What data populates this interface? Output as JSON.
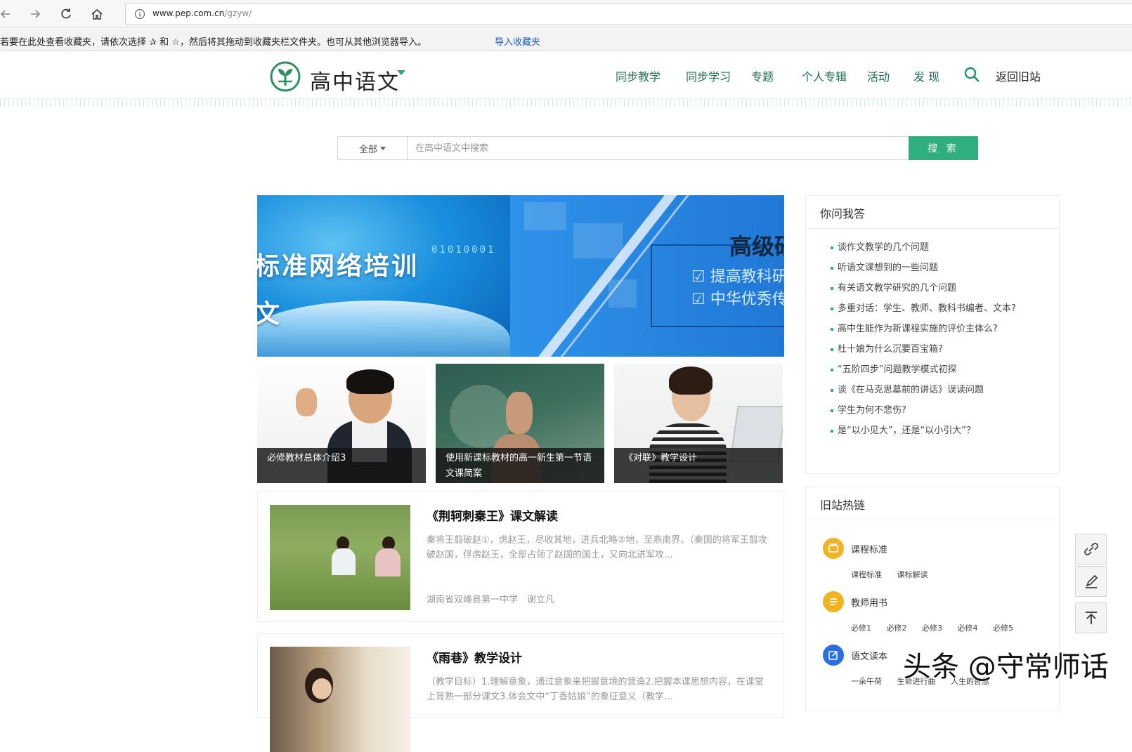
{
  "browser": {
    "url_domain": "www.pep.com.cn",
    "url_path": "/gzyw/",
    "favbar_message": "若要在此处查看收藏夹，请依次选择 ✰ 和 ☆，然后将其拖动到收藏夹栏文件夹。也可从其他浏览器导入。",
    "import_link": "导入收藏夹"
  },
  "header": {
    "site_title": "高中语文",
    "nav": [
      "同步教学",
      "同步学习",
      "专题",
      "个人专辑",
      "活动",
      "发 现"
    ],
    "back_old": "返回旧站",
    "brand_color": "#2eaf7d"
  },
  "search": {
    "scope": "全部",
    "placeholder": "在高中语文中搜索",
    "button": "搜 索"
  },
  "banner": {
    "left_text": "标准网络培训",
    "left_sub": "文",
    "digits": "01010001",
    "right_title": "高级研",
    "checks": [
      "☑ 提高教科研",
      "☑ 中华优秀传"
    ]
  },
  "thumbs": [
    {
      "caption": "必修教材总体介绍3"
    },
    {
      "caption": "使用新课标教材的高一新生第一节语文课简案"
    },
    {
      "caption": "《对联》教学设计"
    }
  ],
  "articles": [
    {
      "title": "《荆轲刺秦王》课文解读",
      "excerpt": "秦将王翦破赵①，虏赵王，尽收其地，进兵北略②地，至燕南界。（秦国的将军王翦攻破赵国，俘虏赵王，全部占领了赵国的国土，又向北进军攻...",
      "meta": "湖南省双峰县第一中学　谢立凡"
    },
    {
      "title": "《雨巷》教学设计",
      "excerpt": "（教学目标）1.理解意象，通过意象来把握意境的营造2.把握本课思想内容，在课堂上背熟一部分课文3.体会文中“丁香姑娘”的象征意义（教学..."
    }
  ],
  "qa": {
    "title": "你问我答",
    "items": [
      "谈作文教学的几个问题",
      "听语文课想到的一些问题",
      "有关语文教学研究的几个问题",
      "多重对话：学生、教师、教科书编者、文本?",
      "高中生能作为新课程实施的评价主体么?",
      "杜十娘为什么沉要百宝箱?",
      "“五阶四步”问题教学模式初探",
      "谈《在马克思墓前的讲话》误读问题",
      "学生为何不悲伤?",
      "是“以小见大”，还是“以小引大”？"
    ]
  },
  "hotlinks": {
    "title": "旧站热链",
    "groups": [
      {
        "name": "课程标准",
        "links": [
          "课程标准",
          "课标解读"
        ],
        "color": "#f0b323"
      },
      {
        "name": "教师用书",
        "links": [
          "必修1",
          "必修2",
          "必修3",
          "必修4",
          "必修5"
        ],
        "color": "#f0b323"
      },
      {
        "name": "语文读本",
        "links": [
          "一朵午荷",
          "生命进行曲",
          "人生的智慧"
        ],
        "color": "#2a6ee0"
      }
    ]
  },
  "watermark": "头条 @守常师话"
}
